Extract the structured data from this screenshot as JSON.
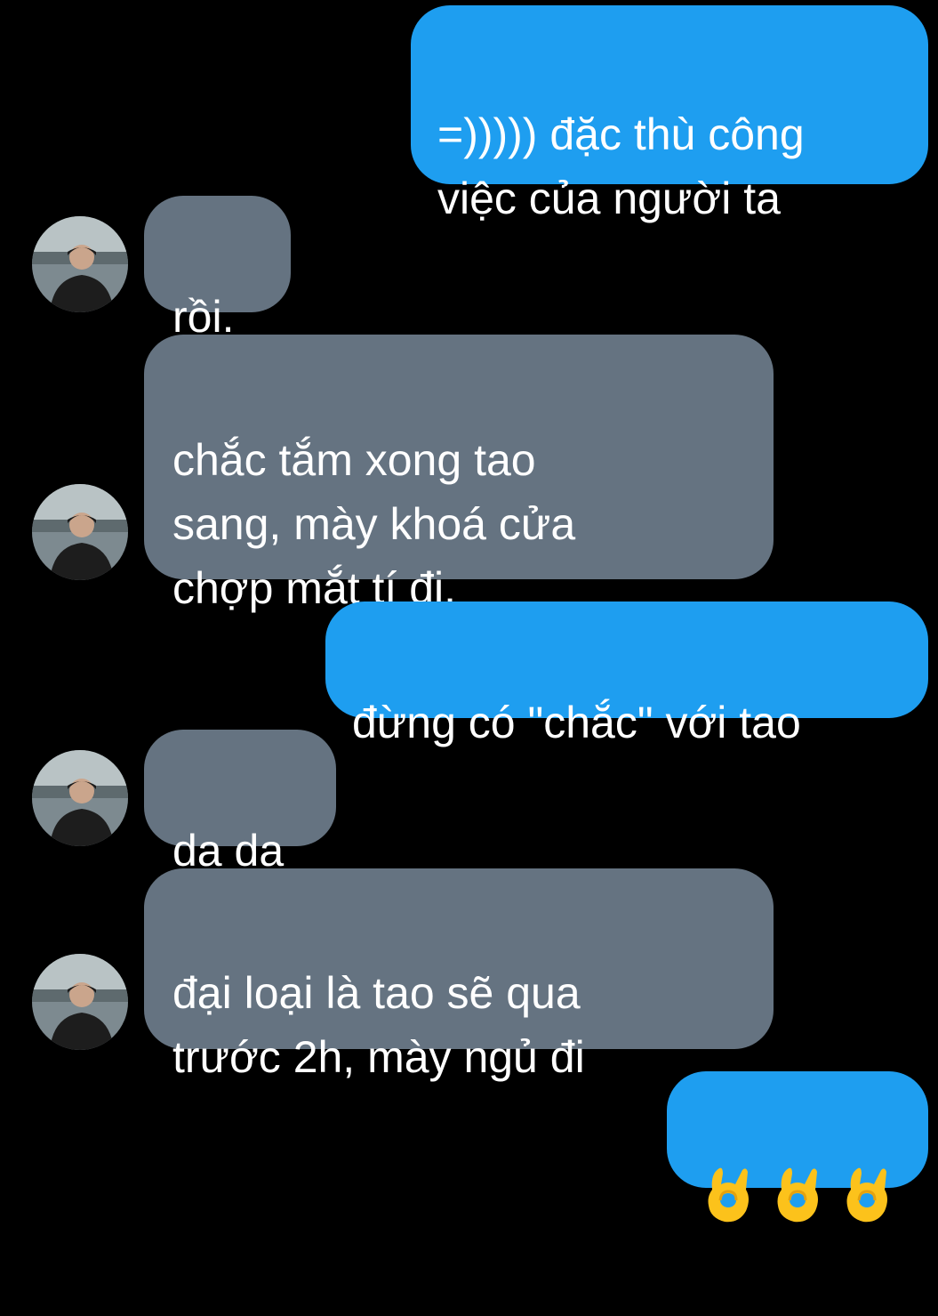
{
  "colors": {
    "background": "#000000",
    "sent_bubble": "#1e9ef0",
    "received_bubble": "#657381",
    "text": "#ffffff"
  },
  "messages": [
    {
      "side": "sent",
      "text": "=))))) đặc thù công\nviệc của người ta"
    },
    {
      "side": "received",
      "text": "rồi."
    },
    {
      "side": "received",
      "text": "chắc tắm xong tao\nsang, mày khoá cửa\nchợp mắt tí đi."
    },
    {
      "side": "sent",
      "text": "đừng có \"chắc\" với tao"
    },
    {
      "side": "received",
      "text": "dạ dạ"
    },
    {
      "side": "received",
      "text": "đại loại là tao sẽ qua\ntrước 2h, mày ngủ đi"
    },
    {
      "side": "sent",
      "icons": [
        "ok-hand-icon",
        "ok-hand-icon",
        "ok-hand-icon"
      ]
    }
  ]
}
